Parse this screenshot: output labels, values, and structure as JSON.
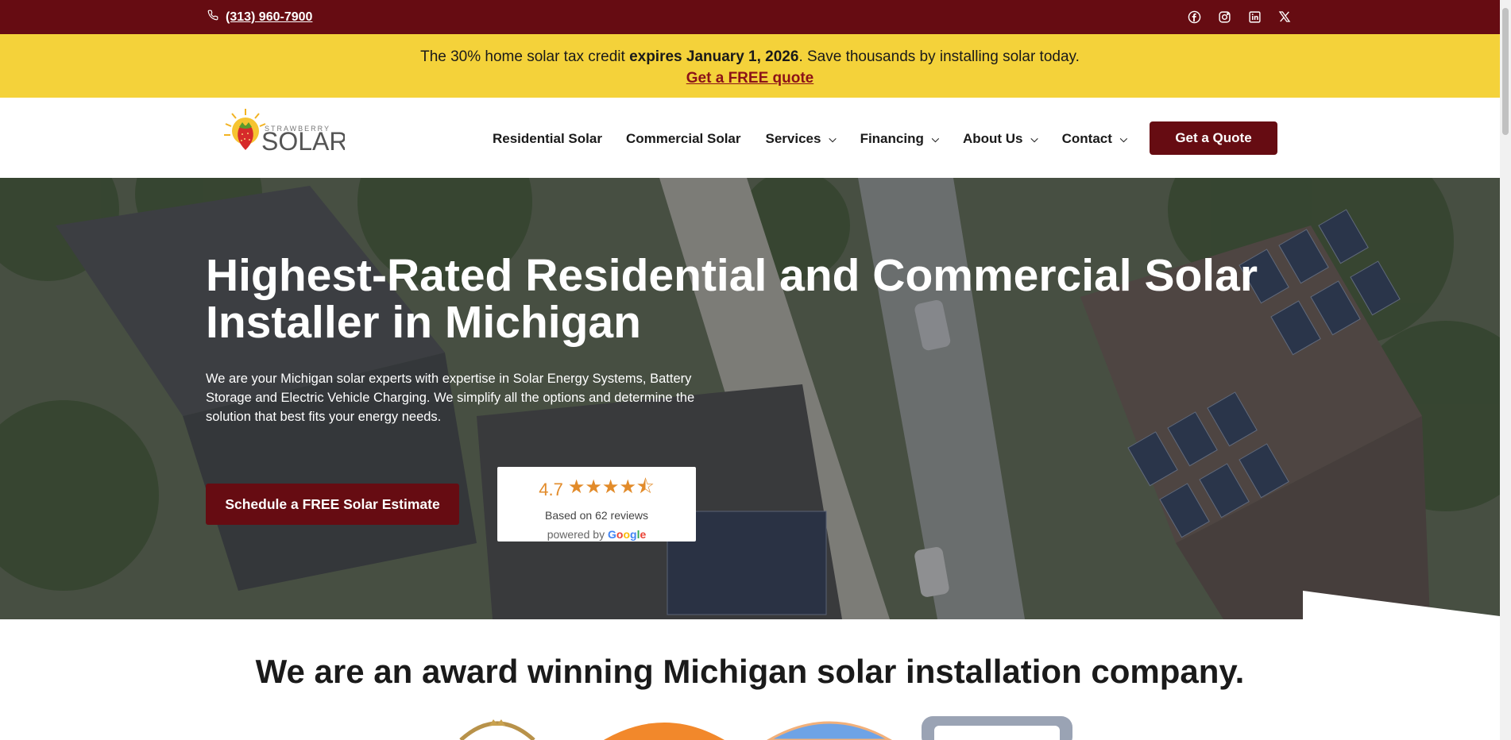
{
  "topbar": {
    "phone": "(313) 960-7900",
    "social": [
      "facebook-icon",
      "instagram-icon",
      "linkedin-icon",
      "x-icon"
    ]
  },
  "promo": {
    "text_before": "The 30% home solar tax credit ",
    "text_bold": "expires January 1, 2026",
    "text_after": ". Save thousands by installing solar today.",
    "link": "Get a FREE quote"
  },
  "nav": {
    "logo_small": "STRAWBERRY",
    "logo_big": "SOLAR",
    "items": [
      {
        "label": "Residential Solar"
      },
      {
        "label": "Commercial Solar"
      },
      {
        "label": "Services"
      },
      {
        "label": "Financing"
      },
      {
        "label": "About Us"
      },
      {
        "label": "Contact"
      }
    ],
    "cta": "Get a Quote"
  },
  "hero": {
    "title": "Highest-Rated Residential and Commercial Solar Installer in Michigan",
    "description": "We are your Michigan solar experts with expertise in Solar Energy Systems, Battery Storage and Electric Vehicle Charging. We simplify all the options and determine the solution that best fits your energy needs.",
    "cta": "Schedule a FREE Solar Estimate",
    "review": {
      "score": "4.7",
      "rating": 4.7,
      "stars": "★★★★⯪",
      "based_on": "Based on 62 reviews",
      "powered_by": "powered by",
      "google": "Google"
    }
  },
  "awards": {
    "title": "We are an award winning Michigan solar installation company."
  },
  "colors": {
    "brand": "#660c12",
    "banner": "#f4d23a",
    "star": "#e28b2a"
  }
}
